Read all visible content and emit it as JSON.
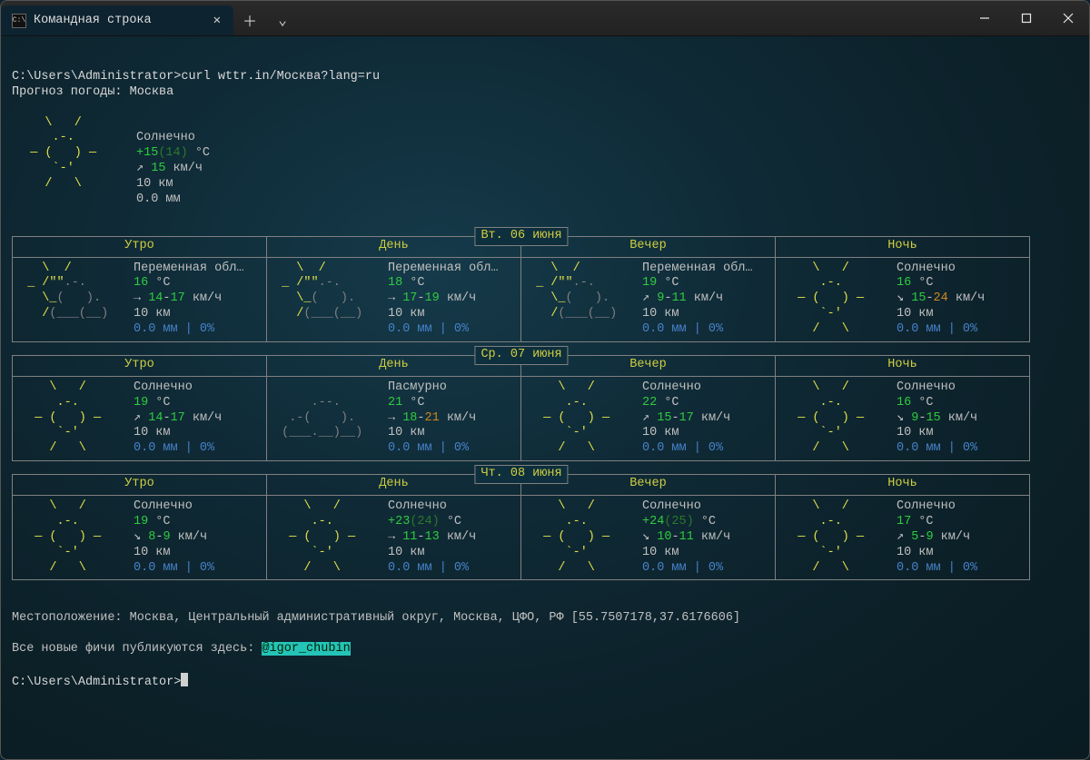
{
  "window": {
    "tab_title": "Командная строка",
    "tab_icon_glyph": "C:\\"
  },
  "prompt1": "C:\\Users\\Administrator>",
  "command": "curl wttr.in/Москва?lang=ru",
  "forecast_header": "Прогноз погоды: Москва",
  "current": {
    "cond": "Солнечно",
    "temp_main": "+15",
    "temp_paren": "(14)",
    "temp_unit": " °C",
    "wind_arrow": "↗",
    "wind_val": "15",
    "wind_unit": " км/ч",
    "vis": "10 км",
    "precip": "0.0 мм"
  },
  "periods": {
    "morning": "Утро",
    "day": "День",
    "evening": "Вечер",
    "night": "Ночь"
  },
  "days": [
    {
      "date": "Вт. 06 июня",
      "cells": [
        {
          "art": "partly",
          "cond": "Переменная обл…",
          "temp": "16",
          "temp_unit": " °C",
          "wa": "→ ",
          "w1": "14",
          "wd": "-",
          "w2": "17",
          "wu": " км/ч",
          "vis": "10 км",
          "pr": "0.0 мм | 0%"
        },
        {
          "art": "partly",
          "cond": "Переменная обл…",
          "temp": "18",
          "temp_unit": " °C",
          "wa": "→ ",
          "w1": "17",
          "wd": "-",
          "w2": "19",
          "wu": " км/ч",
          "vis": "10 км",
          "pr": "0.0 мм | 0%"
        },
        {
          "art": "partly",
          "cond": "Переменная обл…",
          "temp": "19",
          "temp_unit": " °C",
          "wa": "↗ ",
          "w1": "9",
          "wd": "-",
          "w2": "11",
          "wu": " км/ч",
          "vis": "10 км",
          "pr": "0.0 мм | 0%"
        },
        {
          "art": "sunny",
          "cond": "Солнечно",
          "temp": "16",
          "temp_unit": " °C",
          "wa": "↘ ",
          "w1": "15",
          "wd": "-",
          "w2": "24",
          "wu": " км/ч",
          "wind_c2": "org",
          "vis": "10 км",
          "pr": "0.0 мм | 0%"
        }
      ]
    },
    {
      "date": "Ср. 07 июня",
      "cells": [
        {
          "art": "sunny",
          "cond": "Солнечно",
          "temp": "19",
          "temp_unit": " °C",
          "wa": "↗ ",
          "w1": "14",
          "wd": "-",
          "w2": "17",
          "wu": " км/ч",
          "vis": "10 км",
          "pr": "0.0 мм | 0%"
        },
        {
          "art": "overcast",
          "cond": "Пасмурно",
          "temp": "21",
          "temp_unit": " °C",
          "wa": "→ ",
          "w1": "18",
          "wd": "-",
          "w2": "21",
          "wu": " км/ч",
          "wind_c2": "org",
          "vis": "10 км",
          "pr": "0.0 мм | 0%"
        },
        {
          "art": "sunny",
          "cond": "Солнечно",
          "temp": "22",
          "temp_unit": " °C",
          "wa": "↗ ",
          "w1": "15",
          "wd": "-",
          "w2": "17",
          "wu": " км/ч",
          "vis": "10 км",
          "pr": "0.0 мм | 0%"
        },
        {
          "art": "sunny",
          "cond": "Солнечно",
          "temp": "16",
          "temp_unit": " °C",
          "wa": "↘ ",
          "w1": "9",
          "wd": "-",
          "w2": "15",
          "wu": " км/ч",
          "vis": "10 км",
          "pr": "0.0 мм | 0%"
        }
      ]
    },
    {
      "date": "Чт. 08 июня",
      "cells": [
        {
          "art": "sunny",
          "cond": "Солнечно",
          "temp": "19",
          "temp_unit": " °C",
          "wa": "↘ ",
          "w1": "8",
          "wd": "-",
          "w2": "9",
          "wu": " км/ч",
          "vis": "10 км",
          "pr": "0.0 мм | 0%"
        },
        {
          "art": "sunny",
          "cond": "Солнечно",
          "temp": "+23",
          "temp_paren": "(24)",
          "temp_unit": " °C",
          "wa": "→ ",
          "w1": "11",
          "wd": "-",
          "w2": "13",
          "wu": " км/ч",
          "vis": "10 км",
          "pr": "0.0 мм | 0%"
        },
        {
          "art": "sunny",
          "cond": "Солнечно",
          "temp": "+24",
          "temp_paren": "(25)",
          "temp_unit": " °C",
          "wa": "↘ ",
          "w1": "10",
          "wd": "-",
          "w2": "11",
          "wu": " км/ч",
          "vis": "10 км",
          "pr": "0.0 мм | 0%"
        },
        {
          "art": "sunny",
          "cond": "Солнечно",
          "temp": "17",
          "temp_unit": " °C",
          "wa": "↗ ",
          "w1": "5",
          "wd": "-",
          "w2": "9",
          "wu": " км/ч",
          "vis": "10 км",
          "pr": "0.0 мм | 0%"
        }
      ]
    }
  ],
  "location_line": "Местоположение: Москва, Центральный административный округ, Москва, ЦФО, РФ [55.7507178,37.6176606]",
  "news_prefix": "Все новые фичи публикуются здесь: ",
  "news_handle": "@igor_chubin",
  "prompt2": "C:\\Users\\Administrator>"
}
